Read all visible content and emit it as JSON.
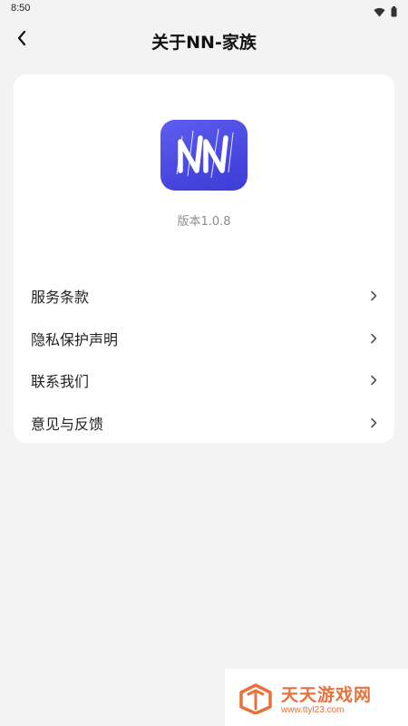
{
  "status_bar": {
    "time": "8:50",
    "icons": [
      "wifi-icon",
      "battery-icon"
    ]
  },
  "nav": {
    "back_icon": "chevron-left-icon",
    "title": "关于NN-家族"
  },
  "app_info": {
    "logo_text": "NN",
    "version": "版本1.0.8",
    "accent_color": "#4a4ae6"
  },
  "menu": {
    "items": [
      {
        "label": "服务条款"
      },
      {
        "label": "隐私保护声明"
      },
      {
        "label": "联系我们"
      },
      {
        "label": "意见与反馈"
      }
    ]
  },
  "watermark": {
    "title": "天天游戏网",
    "url": "www.ttyl23.com",
    "color": "#e8703a"
  }
}
